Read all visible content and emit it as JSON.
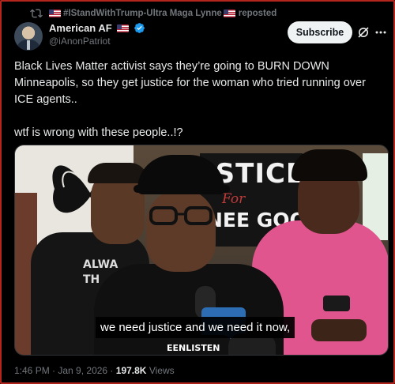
{
  "repost": {
    "user_label": "#IStandWithTrump-Ultra Maga Lynne",
    "action": "reposted"
  },
  "author": {
    "name": "American AF",
    "handle": "@iAnonPatriot"
  },
  "subscribe_label": "Subscribe",
  "tweet": {
    "paragraph1": "Black Lives Matter activist says they’re going to BURN DOWN Minneapolis, so they get justice for the woman who tried running over ICE agents..",
    "paragraph2": "wtf is wrong with these people..!?"
  },
  "media": {
    "caption": "we need justice and we need it now,",
    "sign_main": "JSTICE",
    "sign_for": "For",
    "sign_name": "NEE GOO",
    "shirt_text": "ALWA",
    "shirt_text2": "TH",
    "mic_text": "EENLISTEN"
  },
  "meta": {
    "time": "1:46 PM",
    "separator": " · ",
    "date": "Jan 9, 2026",
    "views_count": "197.8K",
    "views_label": "Views"
  },
  "colors": {
    "accent_blue": "#1d9bf0",
    "frame_red": "#b3261e",
    "muted": "#71767b"
  }
}
